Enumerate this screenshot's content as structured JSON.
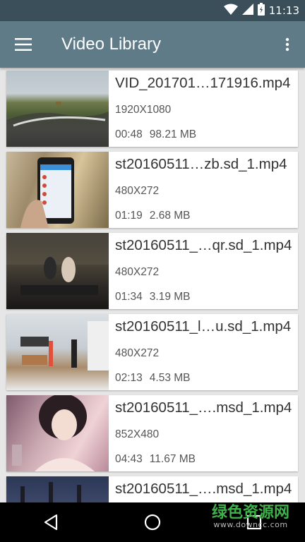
{
  "status_bar": {
    "time": "11:13",
    "icons": [
      "wifi-icon",
      "signal-icon",
      "battery-icon"
    ]
  },
  "app_bar": {
    "title": "Video Library",
    "menu_icon": "hamburger-menu-icon",
    "overflow_icon": "more-vert-icon"
  },
  "videos": [
    {
      "name": "VID_201701…171916.mp4",
      "resolution": "1920X1080",
      "duration": "00:48",
      "size": "98.21 MB"
    },
    {
      "name": "st20160511…zb.sd_1.mp4",
      "resolution": "480X272",
      "duration": "01:19",
      "size": "2.68 MB"
    },
    {
      "name": "st20160511_…qr.sd_1.mp4",
      "resolution": "480X272",
      "duration": "01:34",
      "size": "3.19 MB"
    },
    {
      "name": "st20160511_l…u.sd_1.mp4",
      "resolution": "480X272",
      "duration": "02:13",
      "size": "4.53 MB"
    },
    {
      "name": "st20160511_….msd_1.mp4",
      "resolution": "852X480",
      "duration": "04:43",
      "size": "11.67 MB"
    },
    {
      "name": "st20160511_….msd_1.mp4",
      "resolution": "",
      "duration": "",
      "size": ""
    }
  ],
  "nav_bar": {
    "icons": [
      "back-icon",
      "home-icon",
      "recents-icon"
    ]
  },
  "watermark": {
    "text": "绿色资源网",
    "sub": "www.downcc.com"
  },
  "colors": {
    "status_bar": "#3a4f59",
    "app_bar": "#5f7b88",
    "background": "#e6e6e6"
  }
}
